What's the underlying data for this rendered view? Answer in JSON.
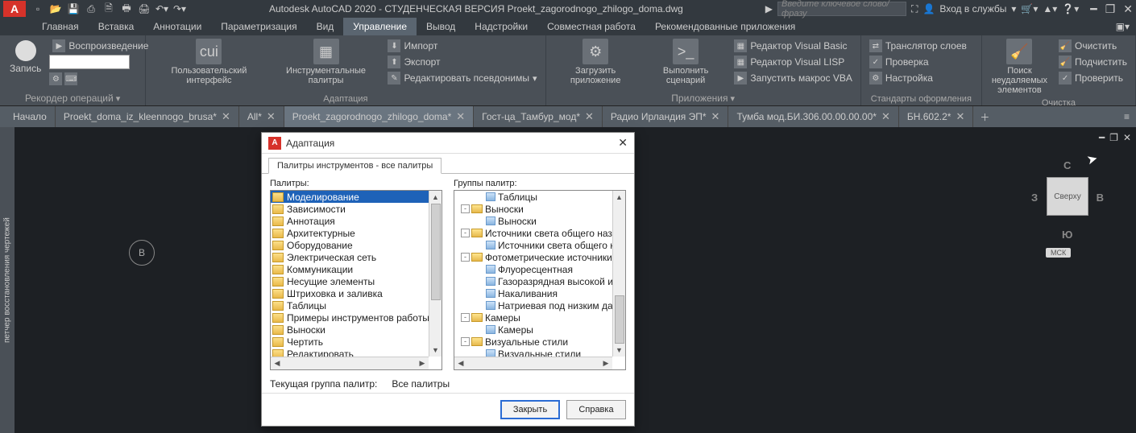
{
  "title": "Autodesk AutoCAD 2020 - СТУДЕНЧЕСКАЯ ВЕРСИЯ   Proekt_zagorodnogo_zhilogo_doma.dwg",
  "searchPlaceholder": "Введите ключевое слово/фразу",
  "signIn": "Вход в службы",
  "menu": [
    "Главная",
    "Вставка",
    "Аннотации",
    "Параметризация",
    "Вид",
    "Управление",
    "Вывод",
    "Надстройки",
    "Совместная работа",
    "Рекомендованные приложения"
  ],
  "activeMenu": 5,
  "ribbon": {
    "recorder": {
      "play": "Воспроизведение",
      "record": "Запись",
      "title": "Рекордер операций"
    },
    "adapt": {
      "cui": "Пользовательский интерфейс",
      "tool": "Инструментальные палитры",
      "import": "Импорт",
      "export": "Экспорт",
      "alias": "Редактировать псевдонимы",
      "title": "Адаптация"
    },
    "apps": {
      "load": "Загрузить приложение",
      "run": "Выполнить сценарий",
      "vbe": "Редактор Visual Basic",
      "vlisp": "Редактор Visual LISP",
      "macro": "Запустить макрос VBA",
      "title": "Приложения"
    },
    "stds": {
      "trans": "Транслятор слоев",
      "check": "Проверка",
      "conf": "Настройка",
      "title": "Стандарты оформления"
    },
    "clean": {
      "find": "Поиск неудаляемых элементов",
      "purge": "Очистить",
      "subpurge": "Подчистить",
      "audit": "Проверить",
      "title": "Очистка"
    }
  },
  "tabs": [
    {
      "label": "Начало",
      "close": false,
      "active": false
    },
    {
      "label": "Proekt_doma_iz_kleennogo_brusa*",
      "close": true,
      "active": false
    },
    {
      "label": "All*",
      "close": true,
      "active": false
    },
    {
      "label": "Proekt_zagorodnogo_zhilogo_doma*",
      "close": true,
      "active": true
    },
    {
      "label": "Гост-ца_Тамбур_мод*",
      "close": true,
      "active": false
    },
    {
      "label": "Радио Ирландия ЭП*",
      "close": true,
      "active": false
    },
    {
      "label": "Тумба мод.БИ.306.00.00.00.00*",
      "close": true,
      "active": false
    },
    {
      "label": "БН.602.2*",
      "close": true,
      "active": false
    }
  ],
  "viewcube": {
    "top": "Сверху",
    "n": "С",
    "s": "Ю",
    "e": "В",
    "w": "З",
    "sys": "МСК"
  },
  "sidepanel": "петчер восстановления чертежей",
  "gridmark": "В",
  "dialog": {
    "title": "Адаптация",
    "tab": "Палитры инструментов - все палитры",
    "palLabel": "Палитры:",
    "grpLabel": "Группы палитр:",
    "palettes": [
      "Моделирование",
      "Зависимости",
      "Аннотация",
      "Архитектурные",
      "Оборудование",
      "Электрическая сеть",
      "Коммуникации",
      "Несущие элементы",
      "Штриховка и заливка",
      "Таблицы",
      "Примеры инструментов работы с ко",
      "Выноски",
      "Чертить",
      "Редактировать"
    ],
    "selected": 0,
    "tree": [
      {
        "d": 1,
        "exp": "",
        "icon": "leaf",
        "t": "Таблицы"
      },
      {
        "d": 0,
        "exp": "-",
        "icon": "f",
        "t": "Выноски"
      },
      {
        "d": 1,
        "exp": "",
        "icon": "leaf",
        "t": "Выноски"
      },
      {
        "d": 0,
        "exp": "-",
        "icon": "f",
        "t": "Источники света общего назнач"
      },
      {
        "d": 1,
        "exp": "",
        "icon": "leaf",
        "t": "Источники света общего наз"
      },
      {
        "d": 0,
        "exp": "-",
        "icon": "f",
        "t": "Фотометрические источники св"
      },
      {
        "d": 1,
        "exp": "",
        "icon": "leaf",
        "t": "Флуоресцентная"
      },
      {
        "d": 1,
        "exp": "",
        "icon": "leaf",
        "t": "Газоразрядная высокой инте"
      },
      {
        "d": 1,
        "exp": "",
        "icon": "leaf",
        "t": "Накаливания"
      },
      {
        "d": 1,
        "exp": "",
        "icon": "leaf",
        "t": "Натриевая под низким давле"
      },
      {
        "d": 0,
        "exp": "-",
        "icon": "f",
        "t": "Камеры"
      },
      {
        "d": 1,
        "exp": "",
        "icon": "leaf",
        "t": "Камеры"
      },
      {
        "d": 0,
        "exp": "-",
        "icon": "f",
        "t": "Визуальные стили"
      },
      {
        "d": 1,
        "exp": "",
        "icon": "leaf",
        "t": "Визуальные стили"
      }
    ],
    "statusLabel": "Текущая группа палитр:",
    "statusValue": "Все палитры",
    "close": "Закрыть",
    "help": "Справка"
  }
}
